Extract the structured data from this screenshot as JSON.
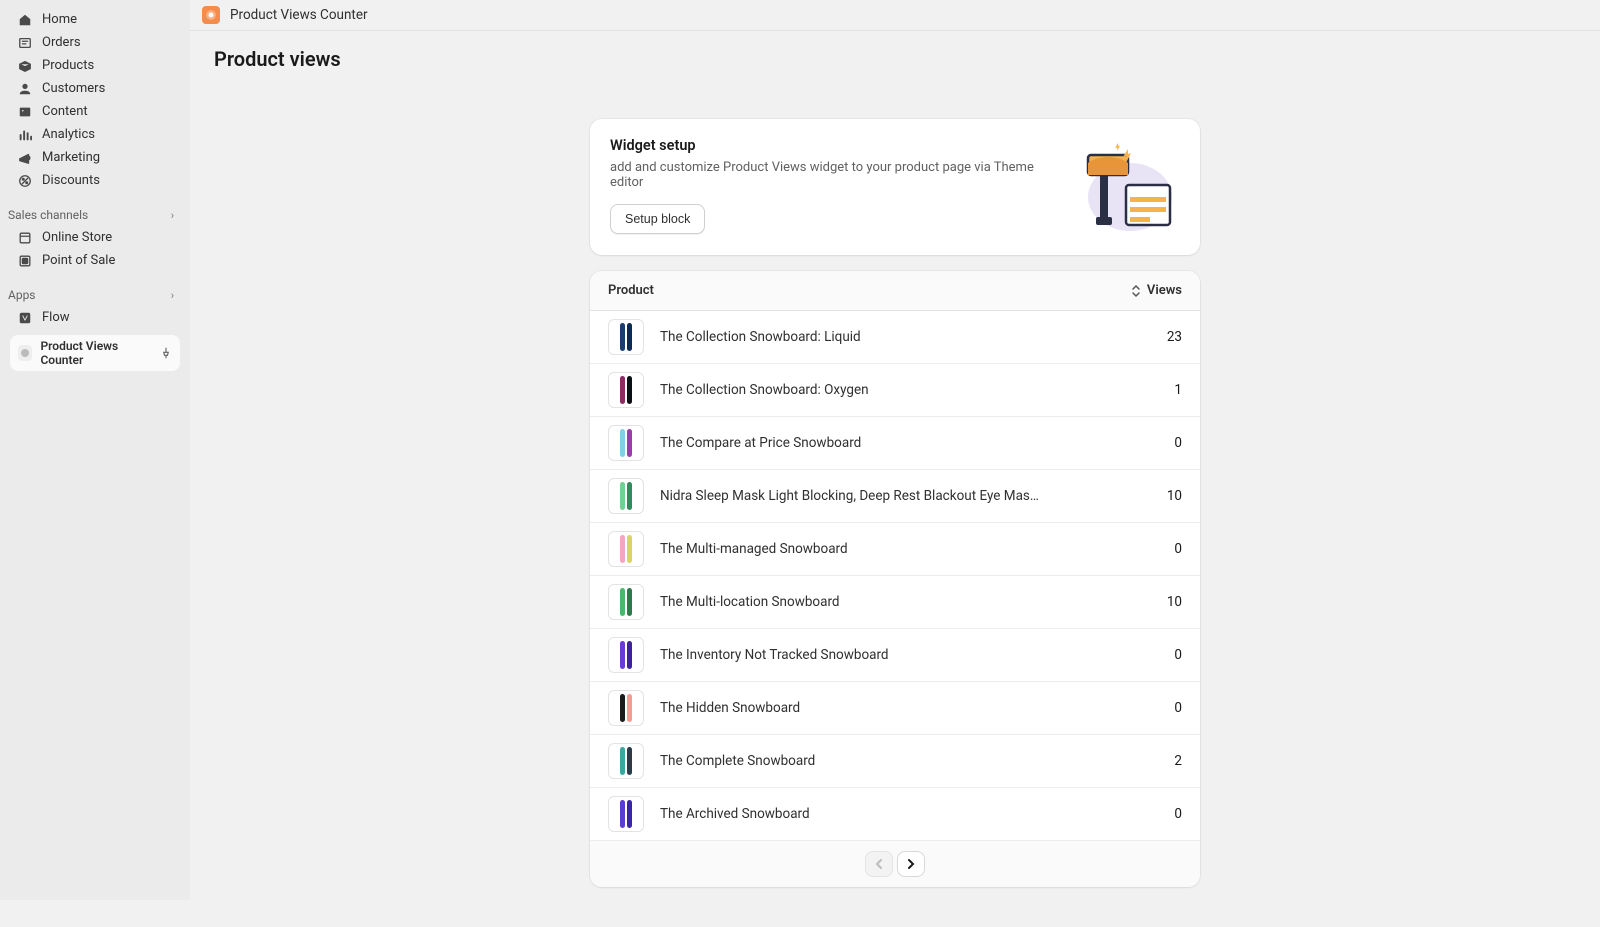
{
  "sidebar": {
    "nav": [
      {
        "icon": "home",
        "label": "Home"
      },
      {
        "icon": "orders",
        "label": "Orders"
      },
      {
        "icon": "products",
        "label": "Products"
      },
      {
        "icon": "customers",
        "label": "Customers"
      },
      {
        "icon": "content",
        "label": "Content"
      },
      {
        "icon": "analytics",
        "label": "Analytics"
      },
      {
        "icon": "marketing",
        "label": "Marketing"
      },
      {
        "icon": "discounts",
        "label": "Discounts"
      }
    ],
    "channels_header": "Sales channels",
    "channels": [
      {
        "icon": "store",
        "label": "Online Store"
      },
      {
        "icon": "pos",
        "label": "Point of Sale"
      }
    ],
    "apps_header": "Apps",
    "apps": [
      {
        "icon": "flow",
        "label": "Flow"
      }
    ],
    "pinned_app": "Product Views Counter"
  },
  "topbar": {
    "app_name": "Product Views Counter"
  },
  "page": {
    "title": "Product views"
  },
  "banner": {
    "heading": "Widget setup",
    "body": "add and customize Product Views widget to your product page via Theme editor",
    "button": "Setup block"
  },
  "table": {
    "col_product": "Product",
    "col_views": "Views",
    "rows": [
      {
        "name": "The Collection Snowboard: Liquid",
        "views": 23,
        "colors": [
          "#1b3d6b",
          "#0e2a52"
        ]
      },
      {
        "name": "The Collection Snowboard: Oxygen",
        "views": 1,
        "colors": [
          "#8b2d62",
          "#0e0f14"
        ]
      },
      {
        "name": "The Compare at Price Snowboard",
        "views": 0,
        "colors": [
          "#82cfe8",
          "#9a3da6"
        ]
      },
      {
        "name": "Nidra Sleep Mask Light Blocking, Deep Rest Blackout Eye Mas…",
        "views": 10,
        "colors": [
          "#6fd193",
          "#338a5c"
        ]
      },
      {
        "name": "The Multi-managed Snowboard",
        "views": 0,
        "colors": [
          "#f3a6c0",
          "#d8d567"
        ]
      },
      {
        "name": "The Multi-location Snowboard",
        "views": 10,
        "colors": [
          "#49b86d",
          "#2e7a4a"
        ]
      },
      {
        "name": "The Inventory Not Tracked Snowboard",
        "views": 0,
        "colors": [
          "#6a3cd6",
          "#3e2396"
        ]
      },
      {
        "name": "The Hidden Snowboard",
        "views": 0,
        "colors": [
          "#1b1b1b",
          "#f39c93"
        ]
      },
      {
        "name": "The Complete Snowboard",
        "views": 2,
        "colors": [
          "#3ba8a0",
          "#2b3b47"
        ]
      },
      {
        "name": "The Archived Snowboard",
        "views": 0,
        "colors": [
          "#5a3cd6",
          "#3826a3"
        ]
      }
    ]
  }
}
